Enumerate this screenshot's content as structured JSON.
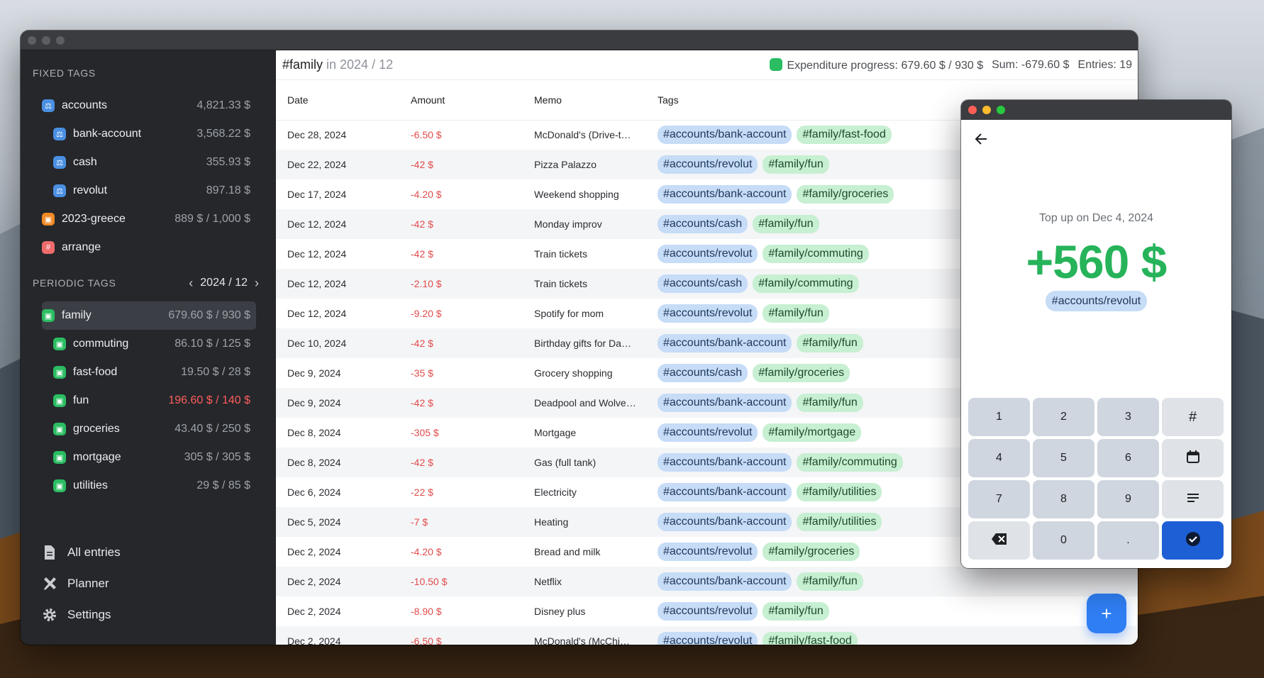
{
  "sidebar": {
    "fixed_header": "FIXED TAGS",
    "fixed_tags": [
      {
        "name": "accounts",
        "value": "4,821.33 $",
        "color": "#4a90e2",
        "icon": "scale-icon"
      },
      {
        "name": "bank-account",
        "value": "3,568.22 $",
        "color": "#4a90e2",
        "icon": "scale-icon"
      },
      {
        "name": "cash",
        "value": "355.93 $",
        "color": "#4a90e2",
        "icon": "scale-icon"
      },
      {
        "name": "revolut",
        "value": "897.18 $",
        "color": "#4a90e2",
        "icon": "scale-icon"
      },
      {
        "name": "2023-greece",
        "value": "889 $ / 1,000 $",
        "color": "#f08a24",
        "icon": "bag-icon"
      },
      {
        "name": "arrange",
        "value": "",
        "color": "#f06b6b",
        "icon": "hash-icon"
      }
    ],
    "periodic_header": "PERIODIC TAGS",
    "period": "2024 / 12",
    "periodic_tags": [
      {
        "name": "family",
        "value": "679.60 $ / 930 $"
      },
      {
        "name": "commuting",
        "value": "86.10 $ / 125 $"
      },
      {
        "name": "fast-food",
        "value": "19.50 $ / 28 $"
      },
      {
        "name": "fun",
        "value": "196.60 $ / 140 $"
      },
      {
        "name": "groceries",
        "value": "43.40 $ / 250 $"
      },
      {
        "name": "mortgage",
        "value": "305 $ / 305 $"
      },
      {
        "name": "utilities",
        "value": "29 $ / 85 $"
      }
    ],
    "nav": {
      "all_entries": "All entries",
      "planner": "Planner",
      "settings": "Settings"
    }
  },
  "header": {
    "tag": "#family",
    "in_text": " in 2024 / 12",
    "progress": "Expenditure progress: 679.60 $ / 930 $",
    "sum": "Sum: -679.60 $",
    "entries": "Entries: 19"
  },
  "table": {
    "columns": [
      "Date",
      "Amount",
      "Memo",
      "Tags"
    ],
    "rows": [
      {
        "date": "Dec 28, 2024",
        "amount": "-6.50 $",
        "memo": "McDonald's (Drive-t…",
        "tags": [
          "#accounts/bank-account",
          "#family/fast-food"
        ]
      },
      {
        "date": "Dec 22, 2024",
        "amount": "-42 $",
        "memo": "Pizza Palazzo",
        "tags": [
          "#accounts/revolut",
          "#family/fun"
        ]
      },
      {
        "date": "Dec 17, 2024",
        "amount": "-4.20 $",
        "memo": "Weekend shopping",
        "tags": [
          "#accounts/bank-account",
          "#family/groceries"
        ]
      },
      {
        "date": "Dec 12, 2024",
        "amount": "-42 $",
        "memo": "Monday improv",
        "tags": [
          "#accounts/cash",
          "#family/fun"
        ]
      },
      {
        "date": "Dec 12, 2024",
        "amount": "-42 $",
        "memo": "Train tickets",
        "tags": [
          "#accounts/revolut",
          "#family/commuting"
        ]
      },
      {
        "date": "Dec 12, 2024",
        "amount": "-2.10 $",
        "memo": "Train tickets",
        "tags": [
          "#accounts/cash",
          "#family/commuting"
        ]
      },
      {
        "date": "Dec 12, 2024",
        "amount": "-9.20 $",
        "memo": "Spotify for mom",
        "tags": [
          "#accounts/revolut",
          "#family/fun"
        ]
      },
      {
        "date": "Dec 10, 2024",
        "amount": "-42 $",
        "memo": "Birthday gifts for Da…",
        "tags": [
          "#accounts/bank-account",
          "#family/fun"
        ]
      },
      {
        "date": "Dec 9, 2024",
        "amount": "-35 $",
        "memo": "Grocery shopping",
        "tags": [
          "#accounts/cash",
          "#family/groceries"
        ]
      },
      {
        "date": "Dec 9, 2024",
        "amount": "-42 $",
        "memo": "Deadpool and Wolve…",
        "tags": [
          "#accounts/bank-account",
          "#family/fun"
        ]
      },
      {
        "date": "Dec 8, 2024",
        "amount": "-305 $",
        "memo": "Mortgage",
        "tags": [
          "#accounts/revolut",
          "#family/mortgage"
        ]
      },
      {
        "date": "Dec 8, 2024",
        "amount": "-42 $",
        "memo": "Gas (full tank)",
        "tags": [
          "#accounts/bank-account",
          "#family/commuting"
        ]
      },
      {
        "date": "Dec 6, 2024",
        "amount": "-22 $",
        "memo": "Electricity",
        "tags": [
          "#accounts/bank-account",
          "#family/utilities"
        ]
      },
      {
        "date": "Dec 5, 2024",
        "amount": "-7 $",
        "memo": "Heating",
        "tags": [
          "#accounts/bank-account",
          "#family/utilities"
        ]
      },
      {
        "date": "Dec 2, 2024",
        "amount": "-4.20 $",
        "memo": "Bread and milk",
        "tags": [
          "#accounts/revolut",
          "#family/groceries"
        ]
      },
      {
        "date": "Dec 2, 2024",
        "amount": "-10.50 $",
        "memo": "Netflix",
        "tags": [
          "#accounts/bank-account",
          "#family/fun"
        ]
      },
      {
        "date": "Dec 2, 2024",
        "amount": "-8.90 $",
        "memo": "Disney plus",
        "tags": [
          "#accounts/revolut",
          "#family/fun"
        ]
      },
      {
        "date": "Dec 2, 2024",
        "amount": "-6.50 $",
        "memo": "McDonald's (McChi…",
        "tags": [
          "#accounts/revolut",
          "#family/fast-food"
        ]
      }
    ]
  },
  "fab_label": "+",
  "popup": {
    "subtitle": "Top up on Dec 4, 2024",
    "amount": "+560 $",
    "tag": "#accounts/revolut",
    "keys": [
      "1",
      "2",
      "3",
      "#",
      "4",
      "5",
      "6",
      "calendar",
      "7",
      "8",
      "9",
      "memo",
      "backspace",
      "0",
      ".",
      "confirm"
    ]
  },
  "colors": {
    "accent": "#2f7ef3",
    "positive": "#26b35a",
    "negative": "#e14b4b",
    "periodic": "#2bbd62"
  }
}
